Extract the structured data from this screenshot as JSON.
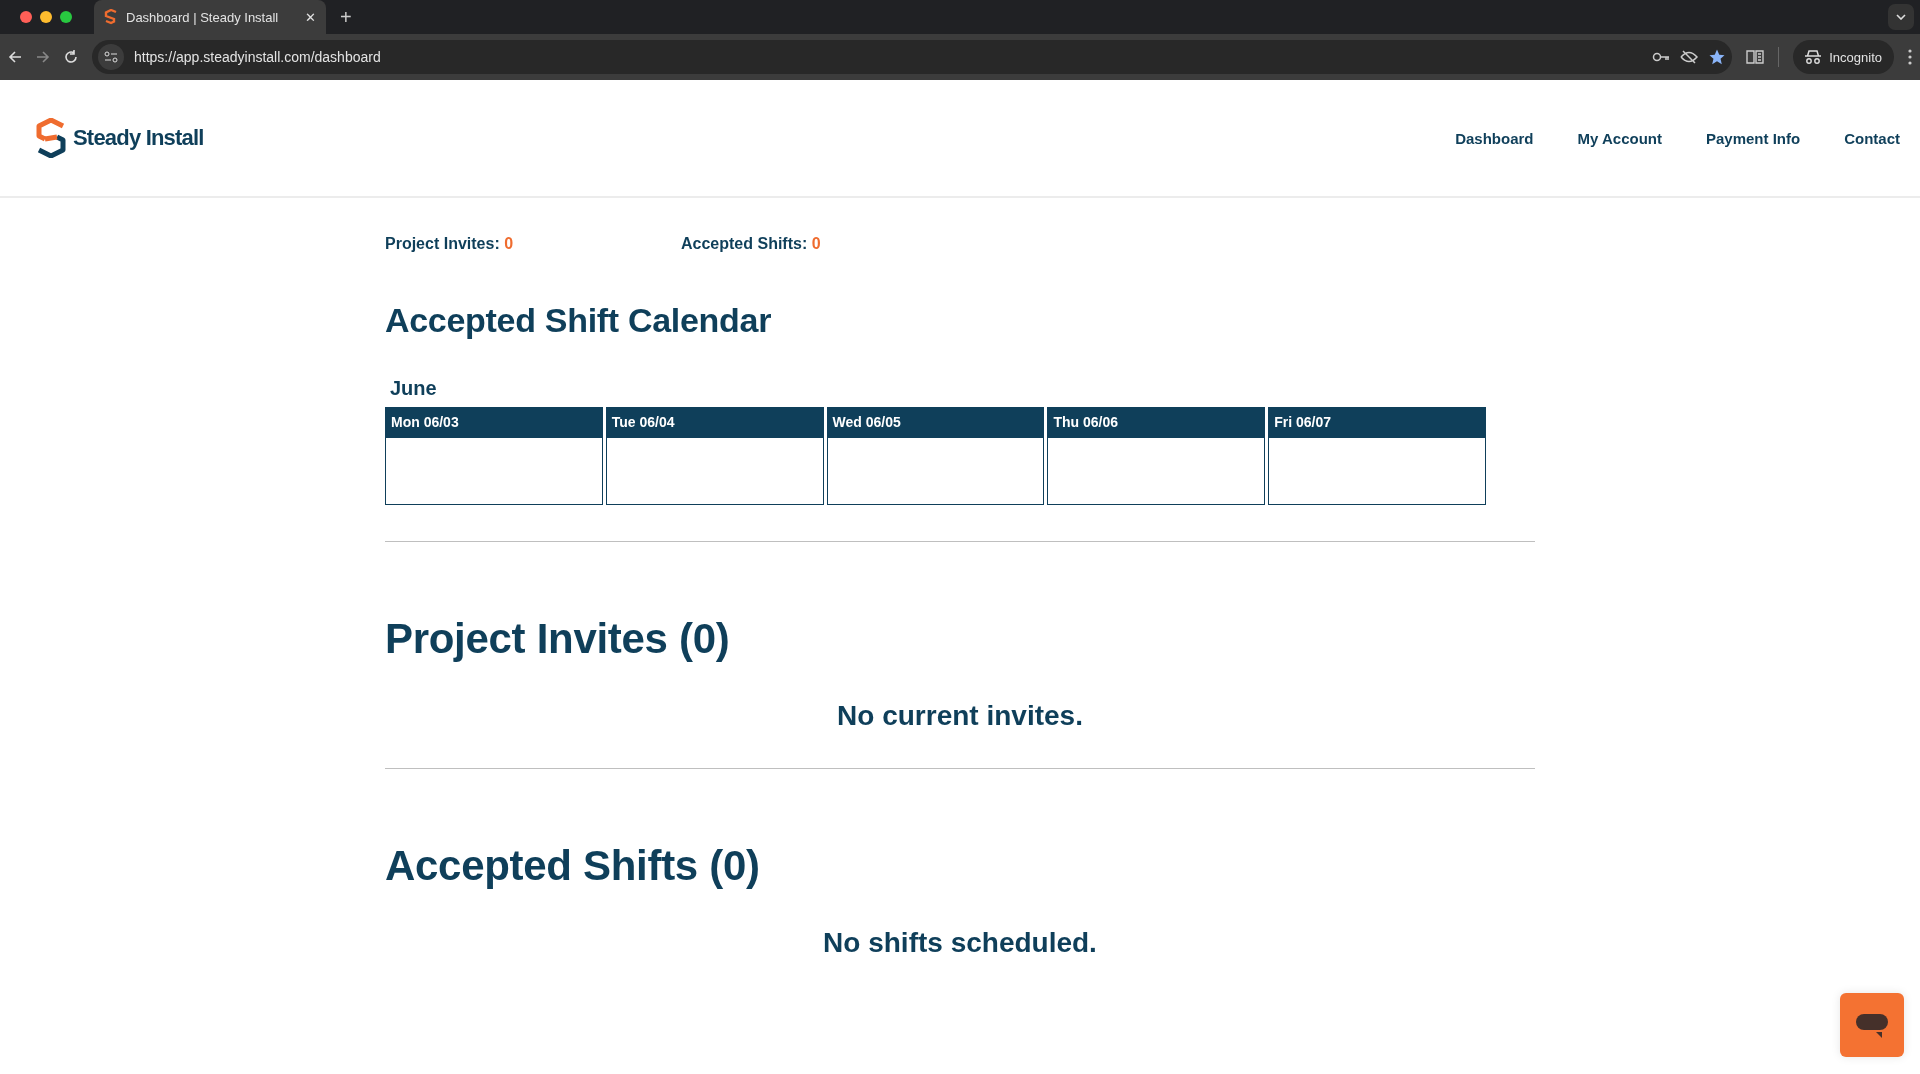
{
  "browser": {
    "tab_title": "Dashboard | Steady Install",
    "url": "https://app.steadyinstall.com/dashboard",
    "bookmarked": true,
    "close_tab": "✕",
    "new_tab": "+",
    "profile": "Incognito"
  },
  "header": {
    "logo": "Steady Install",
    "nav": [
      {
        "label": "Dashboard"
      },
      {
        "label": "My Account"
      },
      {
        "label": "Payment Info"
      },
      {
        "label": "Contact"
      }
    ]
  },
  "stats": [
    {
      "label": "Project Invites:",
      "value": "0"
    },
    {
      "label": "Accepted Shifts:",
      "value": "0"
    }
  ],
  "calendar": {
    "title": "Accepted Shift Calendar",
    "month": "June",
    "days": [
      {
        "label": "Mon 06/03"
      },
      {
        "label": "Tue 06/04"
      },
      {
        "label": "Wed 06/05"
      },
      {
        "label": "Thu 06/06"
      },
      {
        "label": "Fri 06/07"
      }
    ]
  },
  "sections": [
    {
      "title": "Project Invites (0)",
      "empty_message": "No current invites."
    },
    {
      "title": "Accepted Shifts (0)",
      "empty_message": "No shifts scheduled."
    }
  ]
}
